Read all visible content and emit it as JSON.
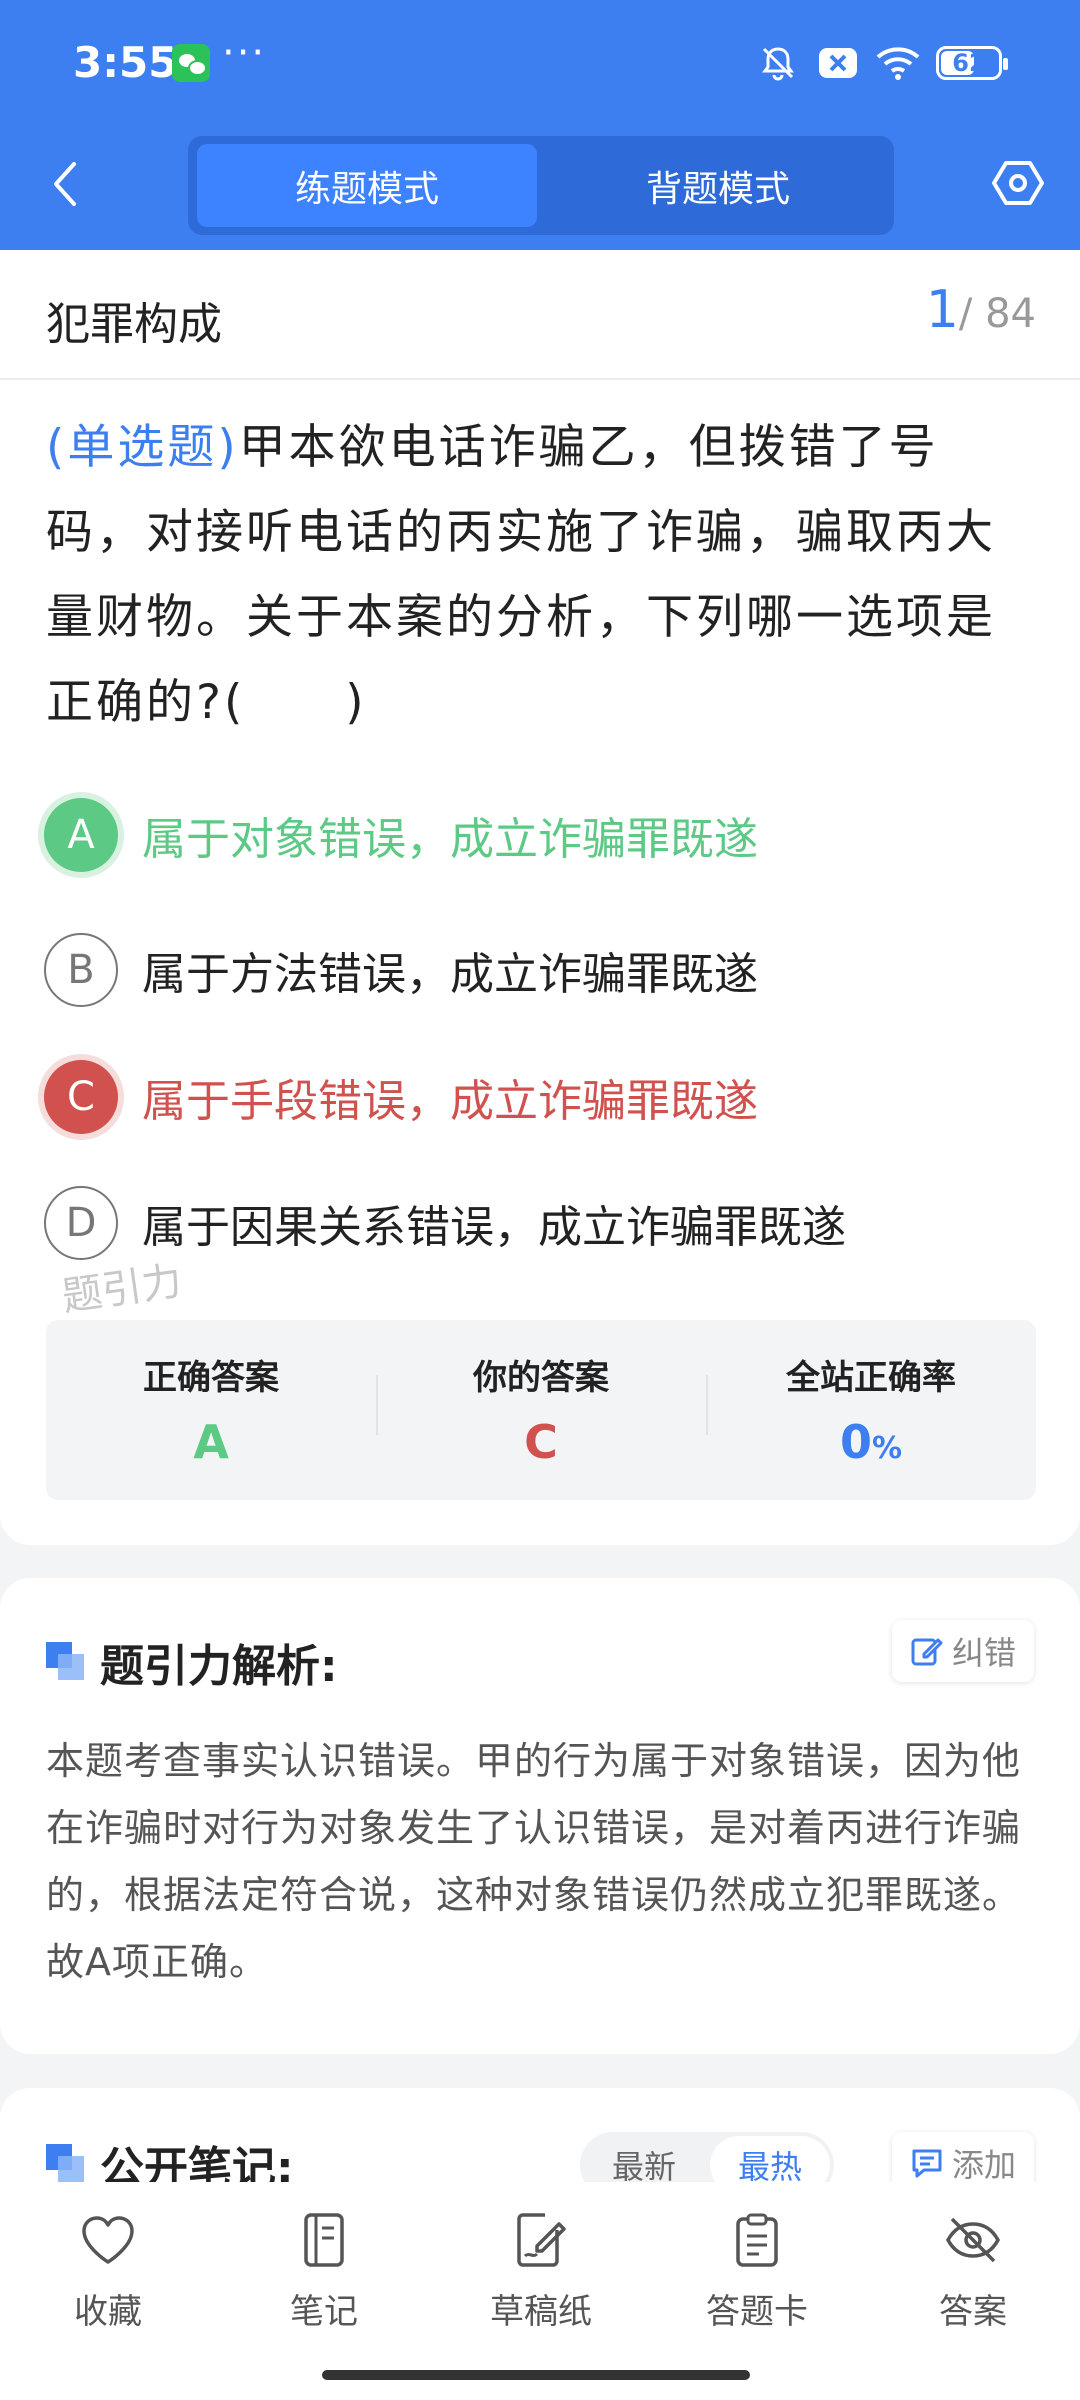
{
  "status_bar": {
    "time": "3:55",
    "battery": "62",
    "battery_level": 0.62,
    "icons": [
      "wechat-icon",
      "more-dots-icon",
      "bell-off-icon",
      "close-box-icon",
      "wifi-icon",
      "battery-icon"
    ]
  },
  "header": {
    "tabs": [
      {
        "label": "练题模式",
        "active": true
      },
      {
        "label": "背题模式",
        "active": false
      }
    ],
    "back_icon": "chevron-left-icon",
    "settings_icon": "hexagon-settings-icon",
    "accent_color": "#3d7ef0"
  },
  "question": {
    "category": "犯罪构成",
    "current": "1",
    "total": "/ 84",
    "type": "(单选题)",
    "stem": "甲本欲电话诈骗乙，但拨错了号码，对接听电话的丙实施了诈骗，骗取丙大量财物。关于本案的分析，下列哪一选项是正确的?(　　)",
    "options": [
      {
        "letter": "A",
        "text": "属于对象错误，成立诈骗罪既遂",
        "state": "correct"
      },
      {
        "letter": "B",
        "text": "属于方法错误，成立诈骗罪既遂",
        "state": "normal"
      },
      {
        "letter": "C",
        "text": "属于手段错误，成立诈骗罪既遂",
        "state": "wrong"
      },
      {
        "letter": "D",
        "text": "属于因果关系错误，成立诈骗罪既遂",
        "state": "normal"
      }
    ],
    "watermark": "题引力",
    "result": {
      "correct_label": "正确答案",
      "correct_value": "A",
      "yours_label": "你的答案",
      "yours_value": "C",
      "rate_label": "全站正确率",
      "rate_value": "0",
      "rate_unit": "%"
    },
    "correct_color": "#5cc985",
    "wrong_color": "#d0514d"
  },
  "analysis": {
    "title": "题引力解析:",
    "correct_button": "纠错",
    "text": "本题考查事实认识错误。甲的行为属于对象错误，因为他在诈骗时对行为对象发生了认识错误，是对着丙进行诈骗的，根据法定符合说，这种对象错误仍然成立犯罪既遂。故A项正确。"
  },
  "notes": {
    "title": "公开笔记:",
    "sort_latest": "最新",
    "sort_hot": "最热",
    "add_button": "添加"
  },
  "bottom_tabs": [
    {
      "label": "收藏",
      "icon": "heart-icon"
    },
    {
      "label": "笔记",
      "icon": "notebook-icon"
    },
    {
      "label": "草稿纸",
      "icon": "draft-icon"
    },
    {
      "label": "答题卡",
      "icon": "clipboard-icon"
    },
    {
      "label": "答案",
      "icon": "eye-off-icon"
    }
  ]
}
